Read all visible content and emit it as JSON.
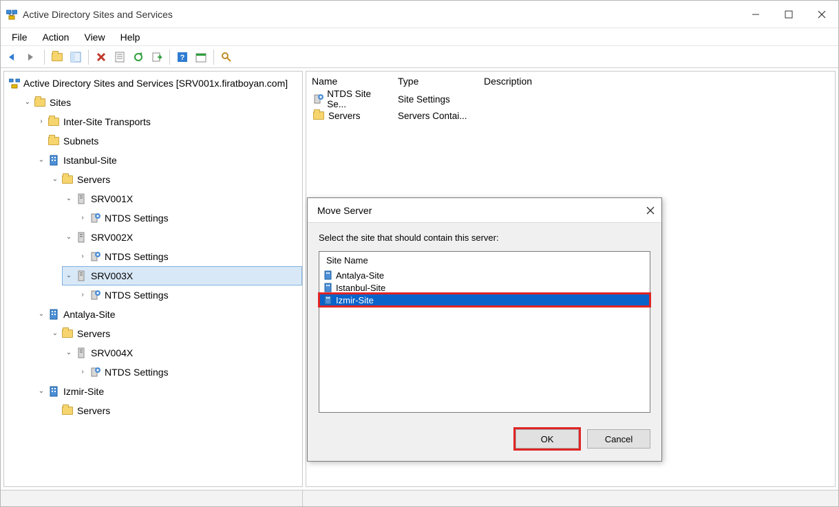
{
  "window": {
    "title": "Active Directory Sites and Services"
  },
  "menubar": [
    "File",
    "Action",
    "View",
    "Help"
  ],
  "tree": {
    "root": "Active Directory Sites and Services [SRV001x.firatboyan.com]",
    "sites": "Sites",
    "inter_site": "Inter-Site Transports",
    "subnets": "Subnets",
    "istanbul": "Istanbul-Site",
    "servers_label": "Servers",
    "srv001x": "SRV001X",
    "srv002x": "SRV002X",
    "srv003x": "SRV003X",
    "ntds": "NTDS Settings",
    "antalya": "Antalya-Site",
    "srv004x": "SRV004X",
    "izmir": "Izmir-Site"
  },
  "list": {
    "col_name": "Name",
    "col_type": "Type",
    "col_desc": "Description",
    "rows": [
      {
        "name": "NTDS Site Se...",
        "type": "Site Settings"
      },
      {
        "name": "Servers",
        "type": "Servers Contai..."
      }
    ]
  },
  "dialog": {
    "title": "Move Server",
    "prompt": "Select the site that should contain this server:",
    "list_header": "Site Name",
    "items": [
      "Antalya-Site",
      "Istanbul-Site",
      "Izmir-Site"
    ],
    "ok": "OK",
    "cancel": "Cancel"
  }
}
